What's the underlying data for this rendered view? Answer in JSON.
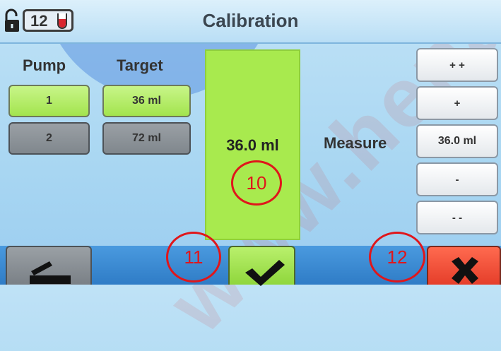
{
  "header": {
    "title": "Calibration",
    "channel_number": "12"
  },
  "watermark": {
    "text": "www.hena"
  },
  "pump_column": {
    "label": "Pump",
    "pumps": [
      {
        "label": "1",
        "state": "selected"
      },
      {
        "label": "2",
        "state": "unselected"
      }
    ]
  },
  "target_column": {
    "label": "Target",
    "targets": [
      {
        "label": "36 ml",
        "state": "selected"
      },
      {
        "label": "72 ml",
        "state": "unselected"
      }
    ]
  },
  "center": {
    "value": "36.0 ml"
  },
  "measure": {
    "label": "Measure",
    "controls": {
      "increase_large": "+ +",
      "increase": "+",
      "value": "36.0 ml",
      "decrease": "-",
      "decrease_large": "- -"
    }
  },
  "footer": {
    "back_icon": "back-icon",
    "confirm_icon": "check-icon",
    "cancel_icon": "close-icon"
  },
  "markers": {
    "m10": "10",
    "m11": "11",
    "m12": "12"
  },
  "colors": {
    "selected": "#a3e44e",
    "unselected": "#858b91",
    "cancel": "#e53e2a",
    "marker": "#e0161b"
  }
}
